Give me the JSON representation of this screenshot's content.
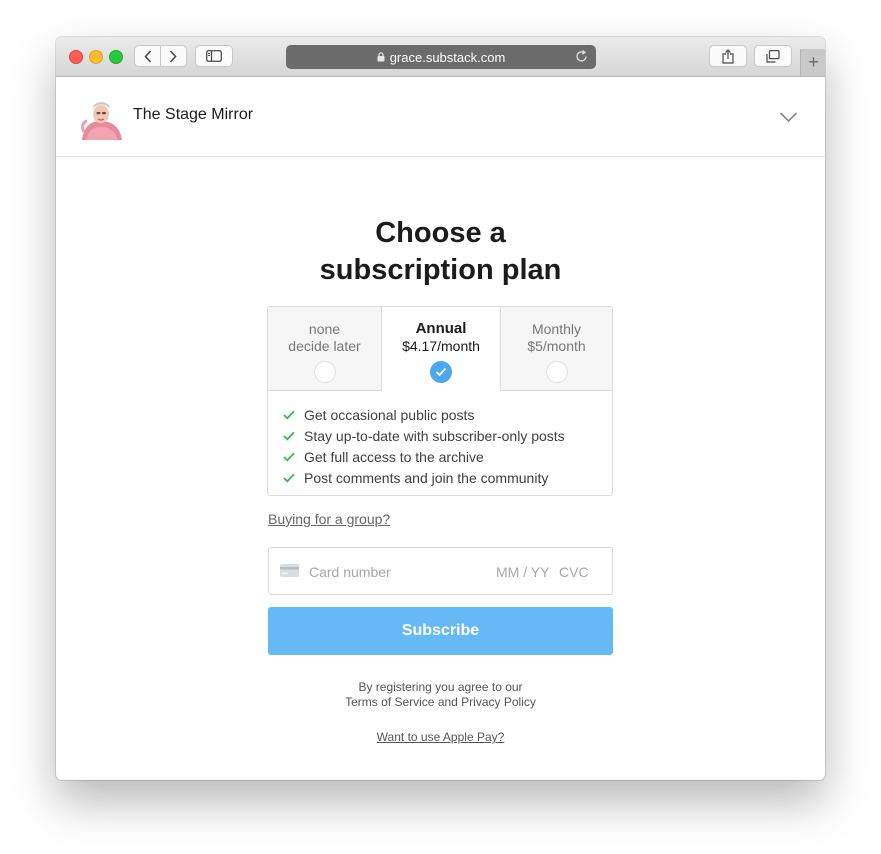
{
  "browser": {
    "url": "grace.substack.com",
    "new_tab_symbol": "+"
  },
  "header": {
    "publication_name": "The Stage Mirror"
  },
  "main": {
    "title_line1": "Choose a",
    "title_line2": "subscription plan",
    "plans": [
      {
        "line1": "none",
        "line2": "decide later",
        "selected": false
      },
      {
        "line1": "Annual",
        "line2": "$4.17/month",
        "selected": true
      },
      {
        "line1": "Monthly",
        "line2": "$5/month",
        "selected": false
      }
    ],
    "features": [
      "Get occasional public posts",
      "Stay up-to-date with subscriber-only posts",
      "Get full access to the archive",
      "Post comments and join the community"
    ],
    "group_link": "Buying for a group?",
    "card": {
      "number_placeholder": "Card number",
      "expiry_placeholder": "MM / YY",
      "cvc_placeholder": "CVC"
    },
    "subscribe_label": "Subscribe",
    "legal_line1": "By registering you agree to our",
    "legal_line2": "Terms of Service and Privacy Policy",
    "apple_pay_link": "Want to use Apple Pay?"
  },
  "colors": {
    "accent": "#66b9f7",
    "radio_selected": "#4ba8f0",
    "check_green": "#3cb94a"
  },
  "icons": {
    "lock": "lock-icon",
    "reload": "reload-icon",
    "check": "check-icon",
    "card": "credit-card-icon",
    "chevron": "chevron-down-icon"
  }
}
